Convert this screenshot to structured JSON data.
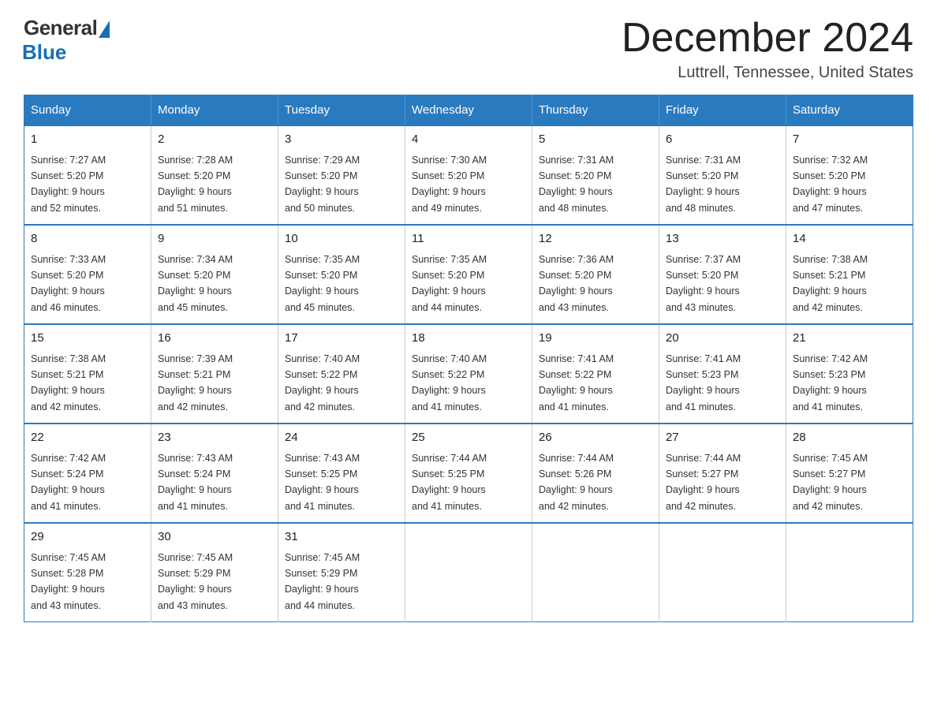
{
  "header": {
    "logo_general": "General",
    "logo_blue": "Blue",
    "month_title": "December 2024",
    "location": "Luttrell, Tennessee, United States"
  },
  "days_of_week": [
    "Sunday",
    "Monday",
    "Tuesday",
    "Wednesday",
    "Thursday",
    "Friday",
    "Saturday"
  ],
  "weeks": [
    [
      {
        "day": "1",
        "sunrise": "7:27 AM",
        "sunset": "5:20 PM",
        "daylight": "9 hours and 52 minutes."
      },
      {
        "day": "2",
        "sunrise": "7:28 AM",
        "sunset": "5:20 PM",
        "daylight": "9 hours and 51 minutes."
      },
      {
        "day": "3",
        "sunrise": "7:29 AM",
        "sunset": "5:20 PM",
        "daylight": "9 hours and 50 minutes."
      },
      {
        "day": "4",
        "sunrise": "7:30 AM",
        "sunset": "5:20 PM",
        "daylight": "9 hours and 49 minutes."
      },
      {
        "day": "5",
        "sunrise": "7:31 AM",
        "sunset": "5:20 PM",
        "daylight": "9 hours and 48 minutes."
      },
      {
        "day": "6",
        "sunrise": "7:31 AM",
        "sunset": "5:20 PM",
        "daylight": "9 hours and 48 minutes."
      },
      {
        "day": "7",
        "sunrise": "7:32 AM",
        "sunset": "5:20 PM",
        "daylight": "9 hours and 47 minutes."
      }
    ],
    [
      {
        "day": "8",
        "sunrise": "7:33 AM",
        "sunset": "5:20 PM",
        "daylight": "9 hours and 46 minutes."
      },
      {
        "day": "9",
        "sunrise": "7:34 AM",
        "sunset": "5:20 PM",
        "daylight": "9 hours and 45 minutes."
      },
      {
        "day": "10",
        "sunrise": "7:35 AM",
        "sunset": "5:20 PM",
        "daylight": "9 hours and 45 minutes."
      },
      {
        "day": "11",
        "sunrise": "7:35 AM",
        "sunset": "5:20 PM",
        "daylight": "9 hours and 44 minutes."
      },
      {
        "day": "12",
        "sunrise": "7:36 AM",
        "sunset": "5:20 PM",
        "daylight": "9 hours and 43 minutes."
      },
      {
        "day": "13",
        "sunrise": "7:37 AM",
        "sunset": "5:20 PM",
        "daylight": "9 hours and 43 minutes."
      },
      {
        "day": "14",
        "sunrise": "7:38 AM",
        "sunset": "5:21 PM",
        "daylight": "9 hours and 42 minutes."
      }
    ],
    [
      {
        "day": "15",
        "sunrise": "7:38 AM",
        "sunset": "5:21 PM",
        "daylight": "9 hours and 42 minutes."
      },
      {
        "day": "16",
        "sunrise": "7:39 AM",
        "sunset": "5:21 PM",
        "daylight": "9 hours and 42 minutes."
      },
      {
        "day": "17",
        "sunrise": "7:40 AM",
        "sunset": "5:22 PM",
        "daylight": "9 hours and 42 minutes."
      },
      {
        "day": "18",
        "sunrise": "7:40 AM",
        "sunset": "5:22 PM",
        "daylight": "9 hours and 41 minutes."
      },
      {
        "day": "19",
        "sunrise": "7:41 AM",
        "sunset": "5:22 PM",
        "daylight": "9 hours and 41 minutes."
      },
      {
        "day": "20",
        "sunrise": "7:41 AM",
        "sunset": "5:23 PM",
        "daylight": "9 hours and 41 minutes."
      },
      {
        "day": "21",
        "sunrise": "7:42 AM",
        "sunset": "5:23 PM",
        "daylight": "9 hours and 41 minutes."
      }
    ],
    [
      {
        "day": "22",
        "sunrise": "7:42 AM",
        "sunset": "5:24 PM",
        "daylight": "9 hours and 41 minutes."
      },
      {
        "day": "23",
        "sunrise": "7:43 AM",
        "sunset": "5:24 PM",
        "daylight": "9 hours and 41 minutes."
      },
      {
        "day": "24",
        "sunrise": "7:43 AM",
        "sunset": "5:25 PM",
        "daylight": "9 hours and 41 minutes."
      },
      {
        "day": "25",
        "sunrise": "7:44 AM",
        "sunset": "5:25 PM",
        "daylight": "9 hours and 41 minutes."
      },
      {
        "day": "26",
        "sunrise": "7:44 AM",
        "sunset": "5:26 PM",
        "daylight": "9 hours and 42 minutes."
      },
      {
        "day": "27",
        "sunrise": "7:44 AM",
        "sunset": "5:27 PM",
        "daylight": "9 hours and 42 minutes."
      },
      {
        "day": "28",
        "sunrise": "7:45 AM",
        "sunset": "5:27 PM",
        "daylight": "9 hours and 42 minutes."
      }
    ],
    [
      {
        "day": "29",
        "sunrise": "7:45 AM",
        "sunset": "5:28 PM",
        "daylight": "9 hours and 43 minutes."
      },
      {
        "day": "30",
        "sunrise": "7:45 AM",
        "sunset": "5:29 PM",
        "daylight": "9 hours and 43 minutes."
      },
      {
        "day": "31",
        "sunrise": "7:45 AM",
        "sunset": "5:29 PM",
        "daylight": "9 hours and 44 minutes."
      },
      null,
      null,
      null,
      null
    ]
  ],
  "labels": {
    "sunrise_prefix": "Sunrise: ",
    "sunset_prefix": "Sunset: ",
    "daylight_prefix": "Daylight: "
  }
}
